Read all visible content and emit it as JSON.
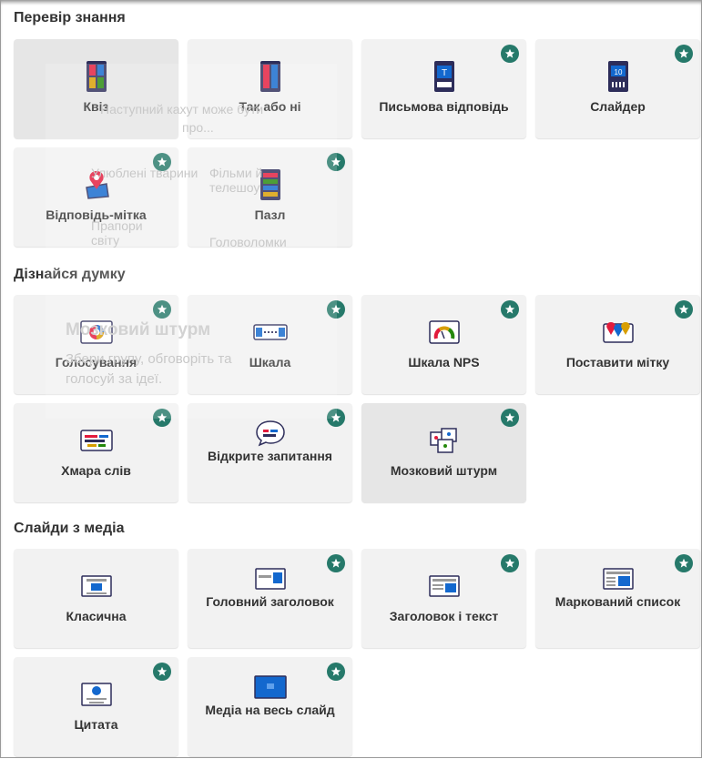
{
  "sections": {
    "knowledge": {
      "title": "Перевір знання",
      "tiles": [
        {
          "label": "Квіз",
          "icon": "quiz-icon",
          "premium": false
        },
        {
          "label": "Так або ні",
          "icon": "true-false-icon",
          "premium": false
        },
        {
          "label": "Письмова відповідь",
          "icon": "type-answer-icon",
          "premium": true
        },
        {
          "label": "Слайдер",
          "icon": "slider-icon",
          "premium": true
        },
        {
          "label": "Відповідь-мітка",
          "icon": "pin-answer-icon",
          "premium": true
        },
        {
          "label": "Пазл",
          "icon": "puzzle-icon",
          "premium": true
        }
      ]
    },
    "opinion": {
      "title": "Дізнайся думку",
      "tiles": [
        {
          "label": "Голосування",
          "icon": "poll-icon",
          "premium": true
        },
        {
          "label": "Шкала",
          "icon": "scale-icon",
          "premium": true
        },
        {
          "label": "Шкала NPS",
          "icon": "nps-scale-icon",
          "premium": true
        },
        {
          "label": "Поставити мітку",
          "icon": "drop-pin-icon",
          "premium": true
        },
        {
          "label": "Хмара слів",
          "icon": "word-cloud-icon",
          "premium": true
        },
        {
          "label": "Відкрите запитання",
          "icon": "open-ended-icon",
          "premium": true
        },
        {
          "label": "Мозковий штурм",
          "icon": "brainstorm-icon",
          "premium": true
        }
      ]
    },
    "media": {
      "title": "Слайди з медіа",
      "tiles": [
        {
          "label": "Класична",
          "icon": "classic-slide-icon",
          "premium": false
        },
        {
          "label": "Головний заголовок",
          "icon": "big-title-icon",
          "premium": true
        },
        {
          "label": "Заголовок і текст",
          "icon": "title-text-icon",
          "premium": true
        },
        {
          "label": "Маркований список",
          "icon": "bullet-list-icon",
          "premium": true
        },
        {
          "label": "Цитата",
          "icon": "quote-icon",
          "premium": true
        },
        {
          "label": "Медіа на весь слайд",
          "icon": "full-media-icon",
          "premium": true
        }
      ]
    }
  },
  "ghost": {
    "line1": "Наступний кахут може бути",
    "line2": "про...",
    "topics": [
      "Улюблені тварини",
      "Фільми й телешоу",
      "Прапори світу",
      "Головоломки"
    ],
    "brainstorm_title": "Мозковий штурм",
    "brainstorm_desc1": "Збери групу, обговоріть та",
    "brainstorm_desc2": "голосуй за ідеї."
  },
  "colors": {
    "tile_bg": "#f2f2f2",
    "badge": "#26796a",
    "text": "#333333"
  }
}
